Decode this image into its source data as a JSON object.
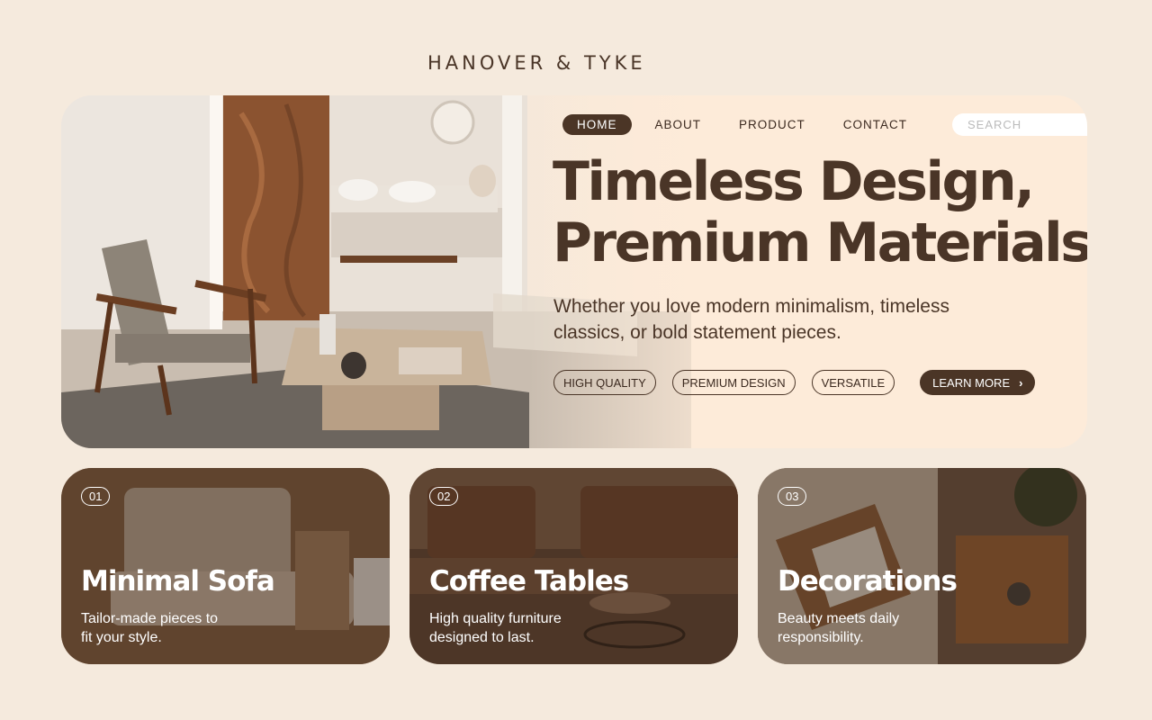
{
  "brand": {
    "name": "HANOVER & TYKE"
  },
  "nav": {
    "items": [
      {
        "label": "HOME",
        "active": true
      },
      {
        "label": "ABOUT",
        "active": false
      },
      {
        "label": "PRODUCT",
        "active": false
      },
      {
        "label": "CONTACT",
        "active": false
      }
    ],
    "search": {
      "placeholder": "SEARCH",
      "value": "",
      "icon": "search-icon"
    }
  },
  "hero": {
    "headline_line1": "Timeless Design,",
    "headline_line2": "Premium Materials",
    "subtext": "Whether you love modern minimalism, timeless classics, or bold statement pieces.",
    "tags": [
      "HIGH QUALITY",
      "PREMIUM DESIGN",
      "VERSATILE"
    ],
    "cta_label": "LEARN MORE",
    "cta_icon": "chevron-right-icon"
  },
  "cards": [
    {
      "number": "01",
      "title": "Minimal Sofa",
      "desc_line1": "Tailor-made pieces to",
      "desc_line2": "fit your style."
    },
    {
      "number": "02",
      "title": "Coffee Tables",
      "desc_line1": "High quality furniture",
      "desc_line2": "designed to last."
    },
    {
      "number": "03",
      "title": "Decorations",
      "desc_line1": "Beauty meets daily",
      "desc_line2": "responsibility."
    }
  ],
  "colors": {
    "background": "#f5eadd",
    "hero_panel": "#fdebd9",
    "accent_brown": "#4b3526",
    "text_dark": "#4a3527"
  }
}
